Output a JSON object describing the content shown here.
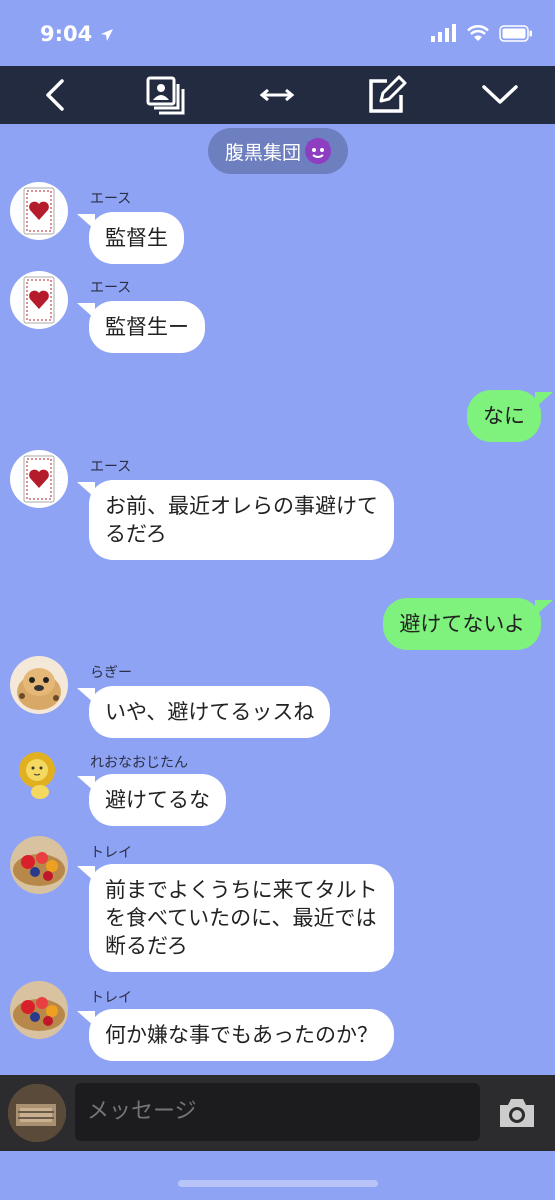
{
  "status_bar": {
    "time": "9:04"
  },
  "chat": {
    "room_name": "腹黒集団",
    "input_placeholder": "メッセージ"
  },
  "messages": [
    {
      "sender": "エース",
      "text": "監督生"
    },
    {
      "sender": "エース",
      "text": "監督生ー"
    },
    {
      "sender": "",
      "text": "なに"
    },
    {
      "sender": "エース",
      "text": "お前、最近オレらの事避けて\nるだろ"
    },
    {
      "sender": "",
      "text": "避けてないよ"
    },
    {
      "sender": "らぎー",
      "text": "いや、避けてるッスね"
    },
    {
      "sender": "れおなおじたん",
      "text": "避けてるな"
    },
    {
      "sender": "トレイ",
      "text": "前までよくうちに来てタルト\nを食べていたのに、最近では\n断るだろ"
    },
    {
      "sender": "トレイ",
      "text": "何か嫌な事でもあったのか？"
    }
  ],
  "colors": {
    "background": "#8fa3f5",
    "toolbar": "#222b40",
    "incoming_bubble": "#ffffff",
    "outgoing_bubble": "#7ef27c"
  }
}
